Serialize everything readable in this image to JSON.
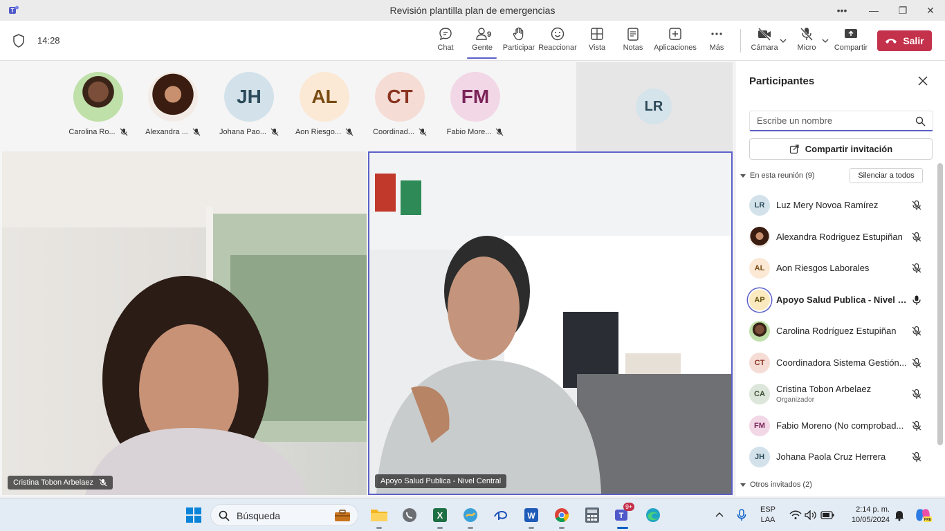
{
  "window": {
    "title": "Revisión plantilla plan de emergencias"
  },
  "toolbar": {
    "time": "14:28",
    "chat": "Chat",
    "people": "Gente",
    "people_count": "9",
    "raise": "Participar",
    "react": "Reaccionar",
    "view": "Vista",
    "notes": "Notas",
    "apps": "Aplicaciones",
    "more": "Más",
    "camera": "Cámara",
    "mic": "Micro",
    "share": "Compartir",
    "leave": "Salir"
  },
  "gallery": [
    {
      "name": "Carolina Ro...",
      "initials": "",
      "type": "photo"
    },
    {
      "name": "Alexandra ...",
      "initials": "",
      "type": "photo"
    },
    {
      "name": "Johana Pao...",
      "initials": "JH",
      "bg": "#d3e2ea",
      "fg": "#2c4a5a"
    },
    {
      "name": "Aon Riesgo...",
      "initials": "AL",
      "bg": "#fbe9d6",
      "fg": "#7a4b12"
    },
    {
      "name": "Coordinad...",
      "initials": "CT",
      "bg": "#f5dcd5",
      "fg": "#8a3420"
    },
    {
      "name": "Fabio More...",
      "initials": "FM",
      "bg": "#f2d7e6",
      "fg": "#7a2459"
    }
  ],
  "spotlight_initials": "LR",
  "videos": {
    "left_name": "Cristina Tobon Arbelaez",
    "right_name": "Apoyo Salud Publica - Nivel Central"
  },
  "panel": {
    "title": "Participantes",
    "search_placeholder": "Escribe un nombre",
    "invite": "Compartir invitación",
    "in_meeting": "En esta reunión (9)",
    "mute_all": "Silenciar a todos",
    "others": "Otros invitados (2)",
    "participants": [
      {
        "initials": "LR",
        "name": "Luz Mery Novoa Ramírez",
        "bg": "#d3e2ea",
        "fg": "#2c4a5a"
      },
      {
        "initials": "",
        "name": "Alexandra Rodriguez Estupiñan",
        "photo": true
      },
      {
        "initials": "AL",
        "name": "Aon Riesgos Laborales",
        "bg": "#fbe9d6",
        "fg": "#7a4b12"
      },
      {
        "initials": "AP",
        "name": "Apoyo Salud Publica - Nivel C...",
        "bg": "#fbeac0",
        "fg": "#6a5310",
        "speaking": true
      },
      {
        "initials": "",
        "name": "Carolina Rodríguez Estupiñan",
        "photo": true
      },
      {
        "initials": "CT",
        "name": "Coordinadora Sistema Gestión...",
        "bg": "#f5dcd5",
        "fg": "#8a3420"
      },
      {
        "initials": "CA",
        "name": "Cristina Tobon Arbelaez",
        "role": "Organizador",
        "bg": "#dde6da",
        "fg": "#3d5236"
      },
      {
        "initials": "FM",
        "name": "Fabio Moreno (No comprobad...",
        "bg": "#f2d7e6",
        "fg": "#7a2459"
      },
      {
        "initials": "JH",
        "name": "Johana Paola Cruz Herrera",
        "bg": "#d3e2ea",
        "fg": "#2c4a5a"
      }
    ]
  },
  "taskbar": {
    "search": "Búsqueda",
    "lang1": "ESP",
    "lang2": "LAA",
    "time": "2:14 p. m.",
    "date": "10/05/2024",
    "teams_badge": "9+"
  }
}
